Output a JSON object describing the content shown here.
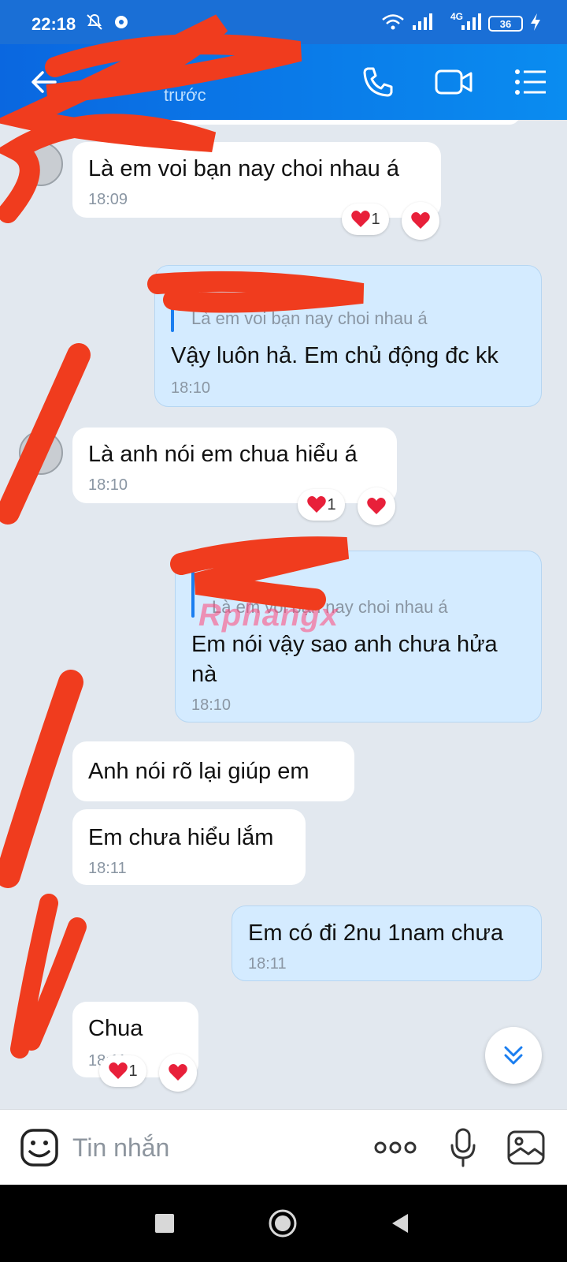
{
  "status_bar": {
    "time": "22:18",
    "network": "4G",
    "battery": "36",
    "icons": [
      "bell-off-icon",
      "settings-icon",
      "wifi-icon",
      "signal-icon",
      "battery-icon",
      "charging-icon"
    ]
  },
  "header": {
    "subtitle": "trước",
    "icons": [
      "back-arrow-icon",
      "phone-icon",
      "video-call-icon",
      "menu-list-icon"
    ]
  },
  "messages": [
    {
      "side": "in",
      "text": "Là em voi bạn nay choi nhau á",
      "time": "18:09",
      "reactions": [
        {
          "emoji": "heart",
          "count": "1"
        },
        {
          "emoji": "heart",
          "count": ""
        }
      ]
    },
    {
      "side": "out",
      "quote": "Là em voi bạn nay choi nhau á",
      "text": "Vậy luôn hả. Em chủ động đc kk",
      "time": "18:10"
    },
    {
      "side": "in",
      "text": "Là anh nói em chua hiểu á",
      "time": "18:10",
      "reactions": [
        {
          "emoji": "heart",
          "count": "1"
        },
        {
          "emoji": "heart",
          "count": ""
        }
      ]
    },
    {
      "side": "out",
      "quote": "Là em voi bạn nay choi nhau á",
      "text_line1": "Em nói vậy sao anh chưa hửa",
      "text_line2": "nà",
      "time": "18:10"
    },
    {
      "side": "in",
      "text": "Anh nói rõ lại giúp em"
    },
    {
      "side": "in",
      "text": "Em chưa hiểu lắm",
      "time": "18:11"
    },
    {
      "side": "out",
      "text": "Em có đi 2nu 1nam chưa",
      "time": "18:11"
    },
    {
      "side": "in",
      "text": "Chua",
      "time": "18:11",
      "reactions": [
        {
          "emoji": "heart",
          "count": "1"
        },
        {
          "emoji": "heart",
          "count": ""
        }
      ]
    }
  ],
  "watermark": "Rphangx",
  "input": {
    "placeholder": "Tin nhắn",
    "icons": [
      "emoji-sticker-icon",
      "more-dots-icon",
      "microphone-icon",
      "image-icon"
    ]
  },
  "nav": {
    "icons": [
      "recents-square-icon",
      "home-circle-icon",
      "back-triangle-icon"
    ]
  },
  "colors": {
    "header": "#0a67e0",
    "chat_background": "#e2e8ef",
    "incoming_bubble": "#ffffff",
    "outgoing_bubble": "#d4ebff",
    "accent": "#1a7ef0",
    "scribble": "#f03c1e",
    "heart": "#e8203a"
  }
}
